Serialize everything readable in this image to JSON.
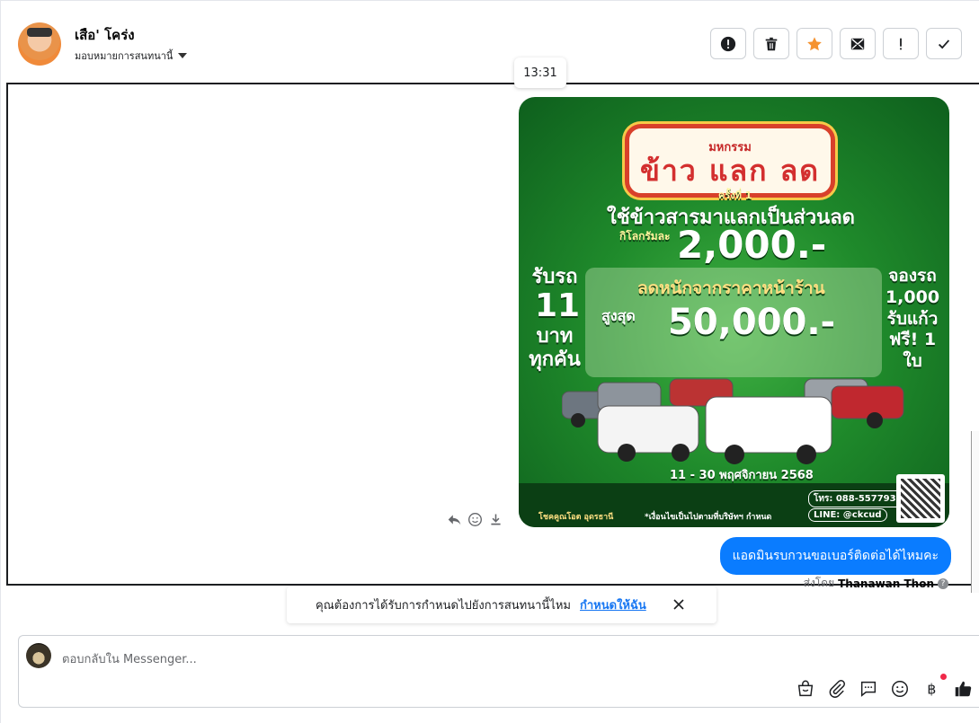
{
  "header": {
    "contact_name": "เสือ' โคร่ง",
    "assign_label": "มอบหมายการสนทนานี้",
    "actions": [
      {
        "name": "report-spam-button",
        "icon": "alert-circle-icon"
      },
      {
        "name": "delete-button",
        "icon": "trash-icon"
      },
      {
        "name": "star-button",
        "icon": "star-icon"
      },
      {
        "name": "mark-unread-button",
        "icon": "envelope-icon"
      },
      {
        "name": "follow-up-button",
        "icon": "exclamation-icon"
      },
      {
        "name": "mark-done-button",
        "icon": "check-icon"
      }
    ]
  },
  "thread": {
    "timestamp": "13:31",
    "poster": {
      "event_small": "มหกรรม",
      "event_big": "ข้าว แลก ลด",
      "round": "ครั้งที่ 1",
      "headline": "ใช้ข้าวสารมาแลกเป็นส่วนลด",
      "per_kg": "กิโลกรัมละ",
      "amount1": "2,000.-",
      "left_line1": "รับรถ",
      "left_num": "11",
      "left_line2": "บาท ทุกคัน",
      "right_lines": "จองรถ 1,000 รับแก้ว ฟรี! 1 ใบ",
      "discount": "ลดหนักจากราคาหน้าร้าน",
      "max_label": "สูงสุด",
      "amount2": "50,000.-",
      "date": "11 - 30 พฤศจิกายน 2568",
      "tel": "โทร: 088-5577932",
      "line": "LINE: @ckcud",
      "condition": "*เงื่อนไขเป็นไปตามที่บริษัทฯ กำหนด",
      "brand": "โชคคูณโอต อุดรธานี"
    },
    "bubble_text": "แอดมินรบกวนขอเบอร์ติดต่อได้ไหมคะ",
    "sent_by_label": "ส่งโดย",
    "sent_by_name": "Thanawan Thon"
  },
  "assign_prompt": {
    "text": "คุณต้องการได้รับการกำหนดไปยังการสนทนานี้ไหม",
    "link": "กำหนดให้ฉัน"
  },
  "composer": {
    "placeholder": "ตอบกลับใน Messenger..."
  },
  "colors": {
    "messenger_blue": "#0a7cff",
    "link_blue": "#1877f2",
    "star": "#f5922f",
    "notify_red": "#f02849"
  }
}
